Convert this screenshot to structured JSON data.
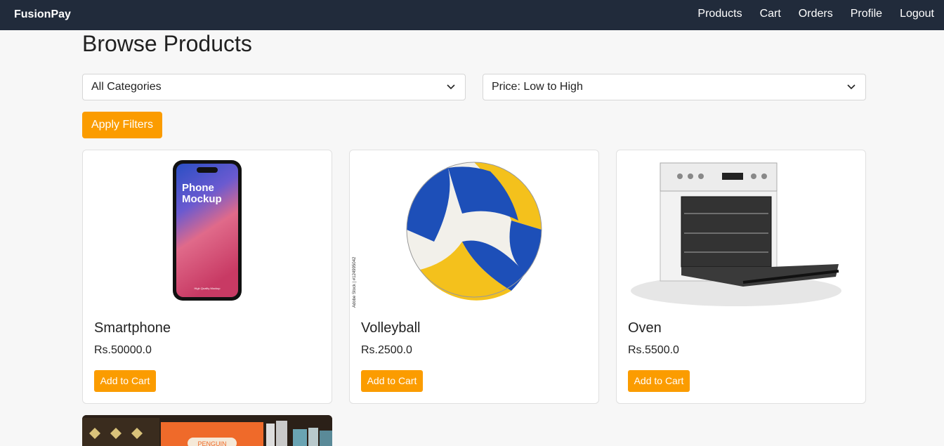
{
  "header": {
    "brand": "FusionPay",
    "nav": [
      "Products",
      "Cart",
      "Orders",
      "Profile",
      "Logout"
    ]
  },
  "main": {
    "title": "Browse Products",
    "category_select": "All Categories",
    "sort_select": "Price: Low to High",
    "apply_label": "Apply Filters"
  },
  "products": [
    {
      "name": "Smartphone",
      "price": "Rs.50000.0",
      "button": "Add to Cart",
      "image_text": [
        "Phone",
        "Mockup"
      ],
      "image_small": "High Quality Mockup"
    },
    {
      "name": "Volleyball",
      "price": "Rs.2500.0",
      "button": "Add to Cart",
      "image_watermark": "Adobe Stock | #124995042"
    },
    {
      "name": "Oven",
      "price": "Rs.5500.0",
      "button": "Add to Cart"
    }
  ],
  "partial_card": {
    "image_text": "PENGUIN"
  },
  "colors": {
    "navbar": "#212b3b",
    "accent": "#fb9c00",
    "background": "#f7f7f7"
  },
  "icons": [
    "chevron-down-icon"
  ]
}
